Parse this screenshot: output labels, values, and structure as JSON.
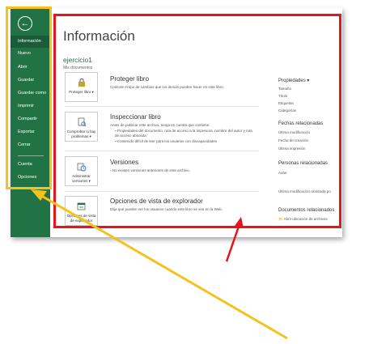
{
  "sidebar": {
    "back_icon": "back-arrow-icon",
    "items": [
      {
        "label": "Información",
        "active": true
      },
      {
        "label": "Nuevo"
      },
      {
        "label": "Abrir"
      },
      {
        "label": "Guardar"
      },
      {
        "label": "Guardar como"
      },
      {
        "label": "Imprimir"
      },
      {
        "label": "Compartir"
      },
      {
        "label": "Exportar"
      },
      {
        "label": "Cerrar"
      },
      {
        "label": "Cuenta"
      },
      {
        "label": "Opciones"
      }
    ]
  },
  "main": {
    "title": "Información",
    "workbook_name": "ejercicio1",
    "location": "Mis documentos",
    "sections": [
      {
        "button_label": "Proteger libro ▾",
        "icon": "lock-icon",
        "heading": "Proteger libro",
        "description": "Controle el tipo de cambios que los demás pueden hacer en este libro."
      },
      {
        "button_label": "Comprobar si hay problemas ▾",
        "icon": "inspect-document-icon",
        "heading": "Inspeccionar libro",
        "description": "Antes de publicar este archivo, tenga en cuenta que contiene:",
        "bullets": [
          "Propiedades del documento, ruta de acceso a la impresora, nombre del autor y ruta de acceso absoluta",
          "Contenido difícil de leer para los usuarios con discapacidades"
        ]
      },
      {
        "button_label": "Administrar versiones ▾",
        "icon": "versions-icon",
        "heading": "Versiones",
        "description": "No existen versiones anteriores de este archivo."
      },
      {
        "button_label": "Opciones de vista de explorador",
        "icon": "browser-view-icon",
        "heading": "Opciones de vista de explorador",
        "description": "Elija qué pueden ver los usuarios cuando este libro se vea en la Web."
      }
    ]
  },
  "properties": {
    "heading": "Propiedades ▾",
    "items": [
      "Tamaño",
      "Título",
      "Etiquetas",
      "Categorías"
    ],
    "dates_heading": "Fechas relacionadas",
    "dates": [
      "Última modificación",
      "Fecha de creación",
      "Última impresión"
    ],
    "people_heading": "Personas relacionadas",
    "people": [
      "Autor"
    ],
    "modified_by": "Última modificación realizada po",
    "docs_heading": "Documentos relacionados",
    "docs": [
      "Abrir ubicación de archivos"
    ]
  },
  "annotations": {
    "yellow_frame_color": "#f5c21c",
    "red_frame_color": "#e8141a"
  }
}
